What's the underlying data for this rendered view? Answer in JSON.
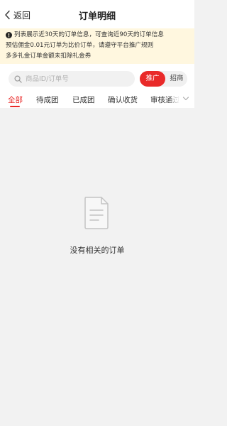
{
  "header": {
    "back_label": "返回",
    "title": "订单明细"
  },
  "notice": {
    "lines": [
      "列表展示近30天的订单信息，可查询近90天的订单信息",
      "预估佣金0.01元订单为比价订单，请遵守平台推广规则",
      "多多礼金订单金额未扣除礼金券"
    ]
  },
  "search": {
    "placeholder": "商品ID/订单号",
    "value": ""
  },
  "mode_toggle": {
    "selected": "推广",
    "other": "招商"
  },
  "tabs": [
    {
      "label": "全部",
      "active": true
    },
    {
      "label": "待成团",
      "active": false
    },
    {
      "label": "已成团",
      "active": false
    },
    {
      "label": "确认收货",
      "active": false
    },
    {
      "label": "审核通过",
      "active": false
    }
  ],
  "empty_state": {
    "message": "没有相关的订单"
  },
  "colors": {
    "accent": "#e92a29",
    "notice_bg": "#fff7df",
    "page_bg": "#f2f2f2"
  }
}
